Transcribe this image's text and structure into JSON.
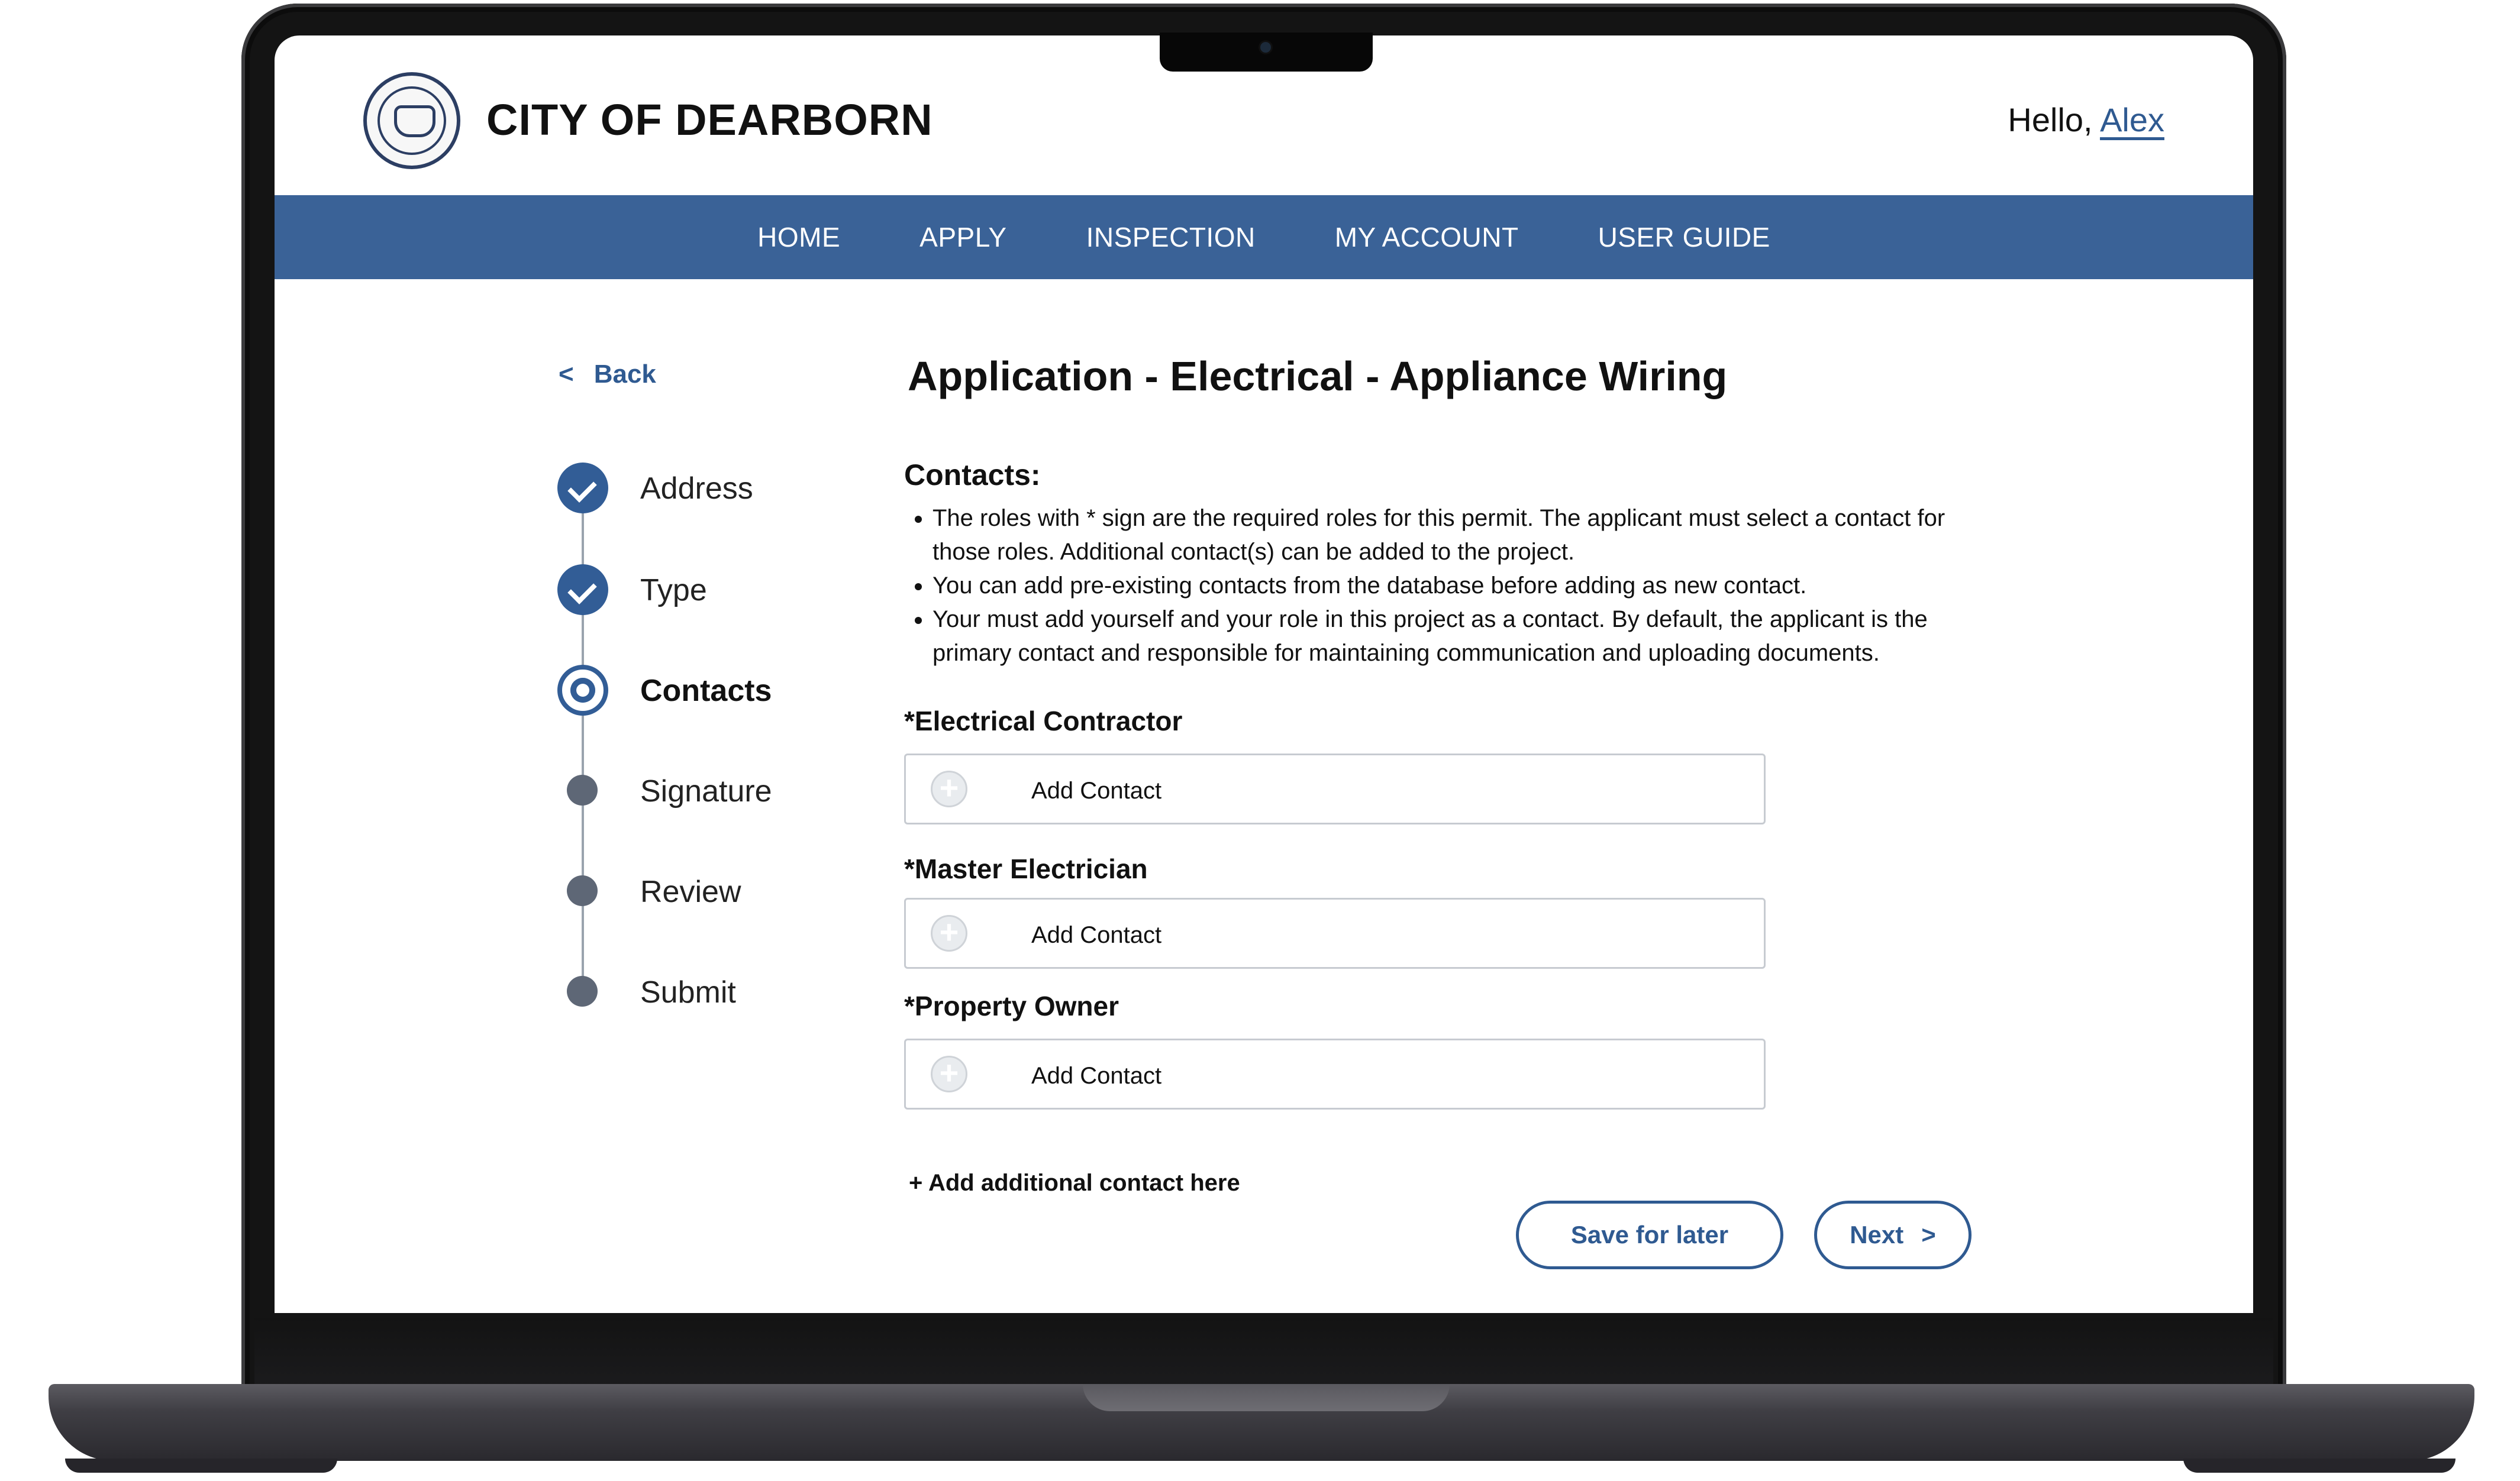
{
  "site": {
    "brand": "CITY OF DEARBORN",
    "greeting": "Hello,",
    "user_name": "Alex"
  },
  "nav": {
    "items": [
      "HOME",
      "APPLY",
      "INSPECTION",
      "MY ACCOUNT",
      "USER GUIDE"
    ]
  },
  "back": {
    "chevron": "<",
    "label": "Back"
  },
  "steps": [
    {
      "label": "Address",
      "state": "done"
    },
    {
      "label": "Type",
      "state": "done"
    },
    {
      "label": "Contacts",
      "state": "current"
    },
    {
      "label": "Signature",
      "state": "todo"
    },
    {
      "label": "Review",
      "state": "todo"
    },
    {
      "label": "Submit",
      "state": "todo"
    }
  ],
  "main": {
    "title": "Application - Electrical - Appliance Wiring",
    "section_heading": "Contacts:",
    "bullets": [
      "The roles with * sign are the required roles for this permit. The applicant must select a contact for those roles. Additional contact(s) can be added to the project.",
      "You can add pre-existing contacts from the database before adding as new contact.",
      "Your must add yourself and your role in this project as a contact. By default, the applicant is the primary contact and responsible for maintaining communication and uploading documents."
    ],
    "roles": [
      {
        "label": "*Electrical Contractor",
        "action": "Add Contact"
      },
      {
        "label": "*Master Electrician",
        "action": "Add Contact"
      },
      {
        "label": "*Property Owner",
        "action": "Add Contact"
      }
    ],
    "add_additional": "+ Add additional contact here",
    "save_label": "Save for later",
    "next_label": "Next",
    "next_chevron": ">"
  },
  "colors": {
    "nav_bg": "#3a6297",
    "accent": "#2f5a91",
    "step_done": "#325d96",
    "step_todo": "#5e6776"
  }
}
